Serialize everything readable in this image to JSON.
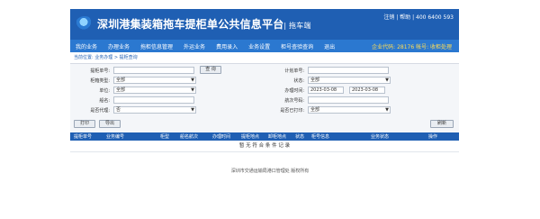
{
  "header": {
    "title": "深圳港集装箱拖车提柜单公共信息平台",
    "subtitle": "| 拖车端",
    "links": "注销 | 帮助 | 400 6400 593"
  },
  "nav": {
    "items": [
      "我的业务",
      "办理业务",
      "拖柜信息管理",
      "外运业务",
      "费用录入",
      "业务设置",
      "柜号查验查询",
      "退出"
    ],
    "info": "企业代码: 28176 帐号: 收柜处理"
  },
  "breadcrumb": "当前位置: 业务办理 > 提柜查询",
  "form": {
    "box_no_label": "提柜单号:",
    "box_no_value": "",
    "query_btn": "查 询",
    "plan_no_label": "计划单号:",
    "plan_no_value": "",
    "type_label": "柜箱类型:",
    "type_value": "全部",
    "status_label": "状态:",
    "status_value": "全部",
    "unit_label": "单位:",
    "unit_value": "全部",
    "time_label": "办理时间:",
    "time_from": "2023-03-08",
    "time_to": "2023-03-08",
    "ship_label": "船名:",
    "ship_value": "",
    "voyage_label": "航次号码:",
    "voyage_value": "",
    "proxy_label": "是否代理:",
    "proxy_value": "否",
    "done_label": "是否已打印:",
    "done_value": "全部",
    "left_btn1": "打印",
    "left_btn2": "导出",
    "right_btn": "刷新"
  },
  "table": {
    "headers": [
      "提柜单号",
      "业务编号",
      "柜型",
      "船名航次",
      "办理时间",
      "提柜地点",
      "卸柜地点",
      "状态",
      "柜号信息",
      "业务状态",
      "操作"
    ],
    "empty_text": "暂 无 符 合 条 件 记 录"
  },
  "footer": "深圳市交通运输局港口管理处 版权所有"
}
